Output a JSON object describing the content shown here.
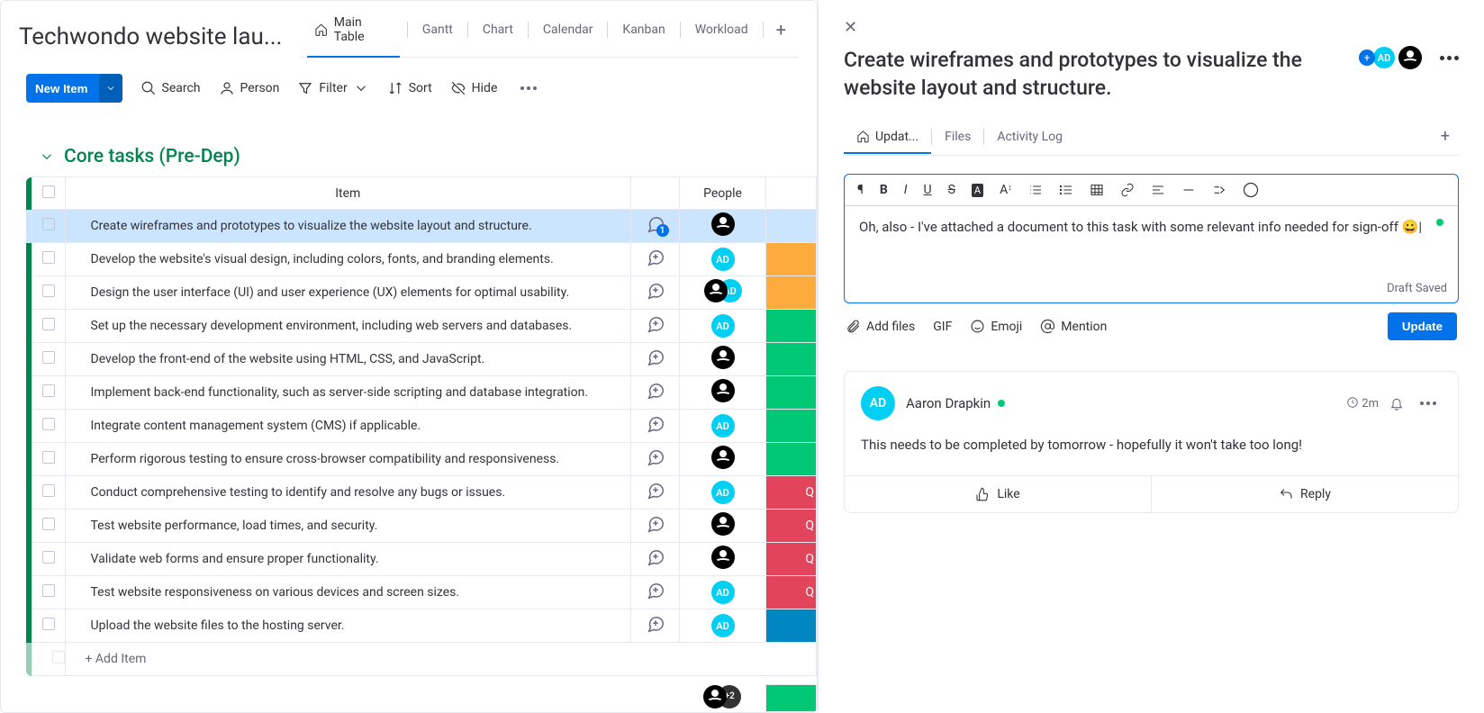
{
  "board": {
    "title": "Techwondo website lau..."
  },
  "tabs": [
    "Main Table",
    "Gantt",
    "Chart",
    "Calendar",
    "Kanban",
    "Workload"
  ],
  "toolbar": {
    "new_item": "New Item",
    "search": "Search",
    "person": "Person",
    "filter": "Filter",
    "sort": "Sort",
    "hide": "Hide"
  },
  "group": {
    "name": "Core tasks (Pre-Dep)"
  },
  "columns": {
    "item": "Item",
    "people": "People"
  },
  "rows": [
    {
      "name": "Create wireframes and prototypes to visualize the website layout and structure.",
      "talk_count": 1,
      "people": "dark",
      "status": "orange",
      "selected": true
    },
    {
      "name": "Develop the website's visual design, including colors, fonts, and branding elements.",
      "people": "ad",
      "status": "orange"
    },
    {
      "name": "Design the user interface (UI) and user experience (UX) elements for optimal usability.",
      "people": "pair",
      "status": "orange"
    },
    {
      "name": "Set up the necessary development environment, including web servers and databases.",
      "people": "ad",
      "status": "green"
    },
    {
      "name": "Develop the front-end of the website using HTML, CSS, and JavaScript.",
      "people": "dark",
      "status": "green"
    },
    {
      "name": "Implement back-end functionality, such as server-side scripting and database integration.",
      "people": "dark",
      "status": "green"
    },
    {
      "name": "Integrate content management system (CMS) if applicable.",
      "people": "ad",
      "status": "green"
    },
    {
      "name": "Perform rigorous testing to ensure cross-browser compatibility and responsiveness.",
      "people": "dark",
      "status": "green"
    },
    {
      "name": "Conduct comprehensive testing to identify and resolve any bugs or issues.",
      "people": "ad",
      "status": "red",
      "status_text": "Q"
    },
    {
      "name": "Test website performance, load times, and security.",
      "people": "dark",
      "status": "red",
      "status_text": "Q"
    },
    {
      "name": "Validate web forms and ensure proper functionality.",
      "people": "dark",
      "status": "red",
      "status_text": "Q"
    },
    {
      "name": "Test website responsiveness on various devices and screen sizes.",
      "people": "ad",
      "status": "red",
      "status_text": "Q"
    },
    {
      "name": "Upload the website files to the hosting server.",
      "people": "ad",
      "status": "blue"
    }
  ],
  "add_item": "+ Add Item",
  "panel": {
    "title": "Create wireframes and prototypes to visualize the website layout and structure.",
    "tabs": {
      "updates": "Updat...",
      "files": "Files",
      "activity": "Activity Log"
    },
    "editor_text": "Oh, also - I've attached a document to this task with some relevant info needed for sign-off 😀|",
    "draft": "Draft Saved",
    "attach": {
      "files": "Add files",
      "gif": "GIF",
      "emoji": "Emoji",
      "mention": "Mention"
    },
    "update_btn": "Update",
    "update": {
      "author": "Aaron Drapkin",
      "initials": "AD",
      "time": "2m",
      "body": "This needs to be completed by tomorrow - hopefully it won't take too long!",
      "like": "Like",
      "reply": "Reply"
    }
  }
}
